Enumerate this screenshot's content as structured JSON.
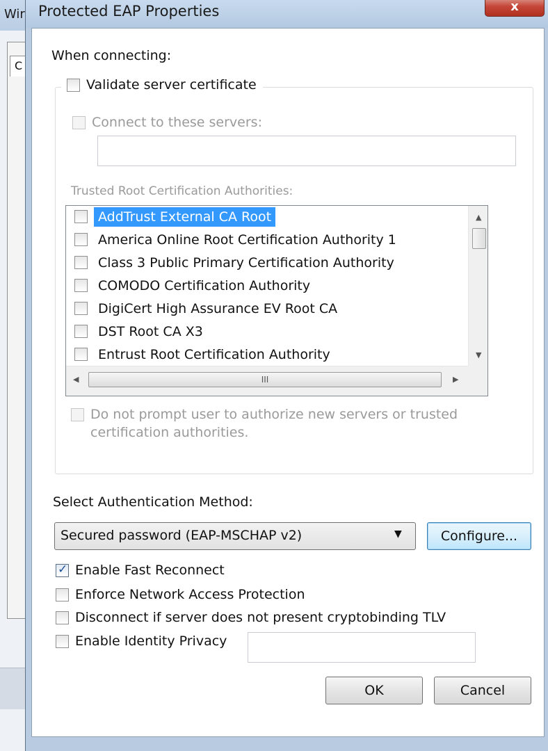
{
  "background_window": {
    "title_fragment": "Wir",
    "tab_fragment": "C"
  },
  "dialog": {
    "title": "Protected EAP Properties",
    "close_glyph": "x"
  },
  "when_connecting": {
    "label": "When connecting:",
    "validate_cert": {
      "label": "Validate server certificate",
      "checked": false
    },
    "connect_servers": {
      "label": "Connect to these servers:",
      "checked": false,
      "disabled": true,
      "value": ""
    },
    "trusted_label": "Trusted Root Certification Authorities:",
    "certificates": [
      {
        "name": "AddTrust External CA Root",
        "checked": false,
        "selected": true
      },
      {
        "name": "America Online Root Certification Authority 1",
        "checked": false
      },
      {
        "name": "Class 3 Public Primary Certification Authority",
        "checked": false
      },
      {
        "name": "COMODO Certification Authority",
        "checked": false
      },
      {
        "name": "DigiCert High Assurance EV Root CA",
        "checked": false
      },
      {
        "name": "DST Root CA X3",
        "checked": false
      },
      {
        "name": "Entrust Root Certification Authority",
        "checked": false
      }
    ],
    "hscroll_grip": "III",
    "no_prompt": {
      "line1": "Do not prompt user to authorize new servers or trusted",
      "line2": "certification authorities.",
      "checked": false,
      "disabled": true
    }
  },
  "auth": {
    "label": "Select Authentication Method:",
    "method": "Secured password (EAP-MSCHAP v2)",
    "configure_label": "Configure..."
  },
  "options": [
    {
      "label": "Enable Fast Reconnect",
      "checked": true
    },
    {
      "label": "Enforce Network Access Protection",
      "checked": false
    },
    {
      "label": "Disconnect if server does not present cryptobinding TLV",
      "checked": false
    },
    {
      "label": "Enable Identity Privacy",
      "checked": false
    }
  ],
  "identity_privacy_value": "",
  "buttons": {
    "ok": "OK",
    "cancel": "Cancel"
  },
  "colors": {
    "selection": "#3399ff",
    "disabled_text": "#9a9a9a",
    "frame": "#b8cbe0"
  }
}
